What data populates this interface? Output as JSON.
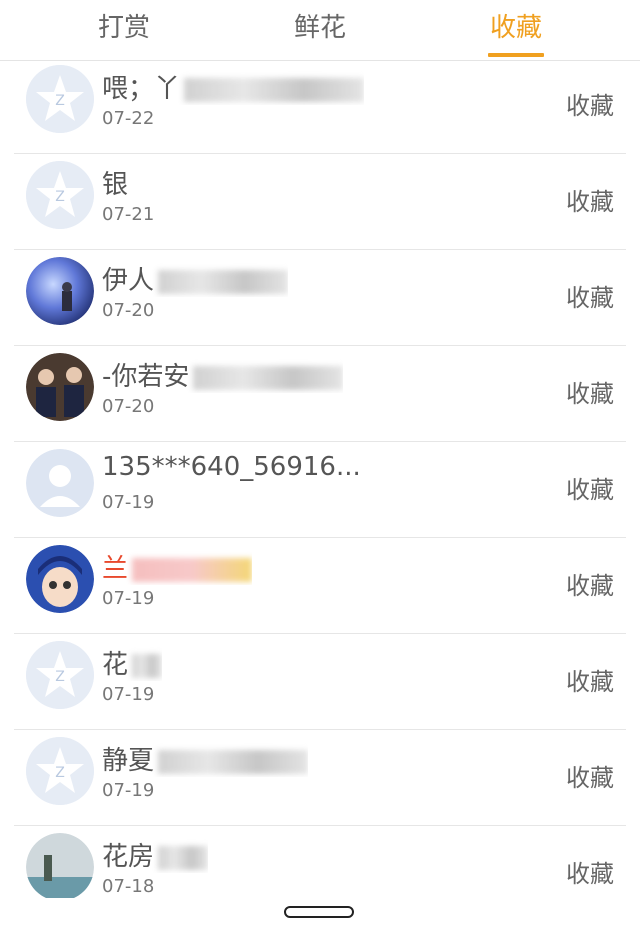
{
  "tabs": [
    {
      "label": "打赏",
      "active": false
    },
    {
      "label": "鲜花",
      "active": false
    },
    {
      "label": "收藏",
      "active": true
    }
  ],
  "colors": {
    "accent": "#f0a020",
    "highlight_name": "#e8492d"
  },
  "rows": [
    {
      "name": "喂；丫",
      "date": "07-22",
      "action": "收藏",
      "avatar": "qq-star-icon",
      "highlight": false
    },
    {
      "name": "银",
      "date": "07-21",
      "action": "收藏",
      "avatar": "qq-star-icon",
      "highlight": false
    },
    {
      "name": "伊人",
      "date": "07-20",
      "action": "收藏",
      "avatar": "photo-avatar-night",
      "highlight": false
    },
    {
      "name": "-你若安",
      "date": "07-20",
      "action": "收藏",
      "avatar": "photo-avatar-girls",
      "highlight": false
    },
    {
      "name": "135***640_56916",
      "date": "07-19",
      "action": "收藏",
      "avatar": "default-person-icon",
      "highlight": false
    },
    {
      "name": "兰",
      "date": "07-19",
      "action": "收藏",
      "avatar": "cartoon-avatar",
      "highlight": true
    },
    {
      "name": "花",
      "date": "07-19",
      "action": "收藏",
      "avatar": "qq-star-icon",
      "highlight": false
    },
    {
      "name": "静夏",
      "date": "07-19",
      "action": "收藏",
      "avatar": "qq-star-icon",
      "highlight": false
    },
    {
      "name": "花房",
      "date": "07-18",
      "action": "收藏",
      "avatar": "photo-avatar-sea",
      "highlight": false
    }
  ]
}
